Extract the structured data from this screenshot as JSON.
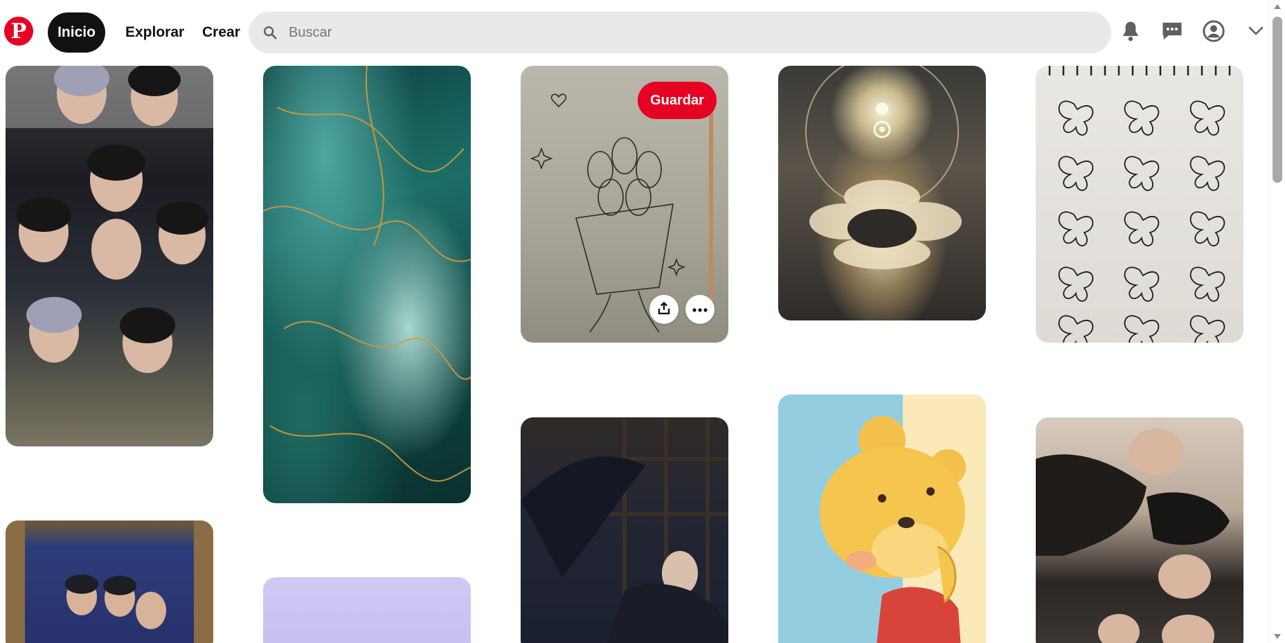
{
  "header": {
    "logo_letter": "P",
    "nav": {
      "home": "Inicio",
      "explore": "Explorar",
      "create": "Crear"
    },
    "search": {
      "placeholder": "Buscar",
      "value": ""
    },
    "icons": [
      "search-icon",
      "bell-icon",
      "messages-icon",
      "account-icon",
      "chevron-down-icon"
    ]
  },
  "colors": {
    "brand": "#e60023",
    "active_nav": "#111111",
    "search_bg": "#e9e9e9"
  },
  "hovered_pin": {
    "save_label": "Guardar",
    "icons": [
      "share-icon",
      "more-icon"
    ]
  },
  "pins": [
    {
      "id": "group-photo"
    },
    {
      "id": "teal-marble"
    },
    {
      "id": "tulip-sketch"
    },
    {
      "id": "clouds-sun"
    },
    {
      "id": "butterfly-doodles"
    },
    {
      "id": "concert-photo"
    },
    {
      "id": "lavender"
    },
    {
      "id": "dark-wings"
    },
    {
      "id": "winnie-pooh"
    },
    {
      "id": "group-selfie"
    }
  ]
}
